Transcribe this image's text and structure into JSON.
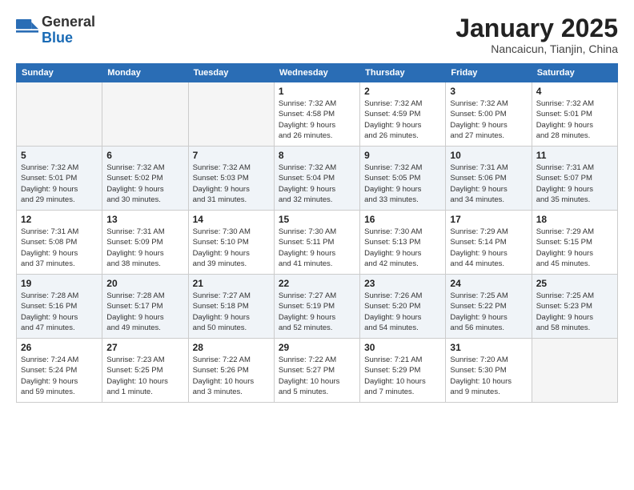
{
  "header": {
    "logo_general": "General",
    "logo_blue": "Blue",
    "month_title": "January 2025",
    "subtitle": "Nancaicun, Tianjin, China"
  },
  "weekdays": [
    "Sunday",
    "Monday",
    "Tuesday",
    "Wednesday",
    "Thursday",
    "Friday",
    "Saturday"
  ],
  "weeks": [
    [
      {
        "day": "",
        "info": ""
      },
      {
        "day": "",
        "info": ""
      },
      {
        "day": "",
        "info": ""
      },
      {
        "day": "1",
        "info": "Sunrise: 7:32 AM\nSunset: 4:58 PM\nDaylight: 9 hours\nand 26 minutes."
      },
      {
        "day": "2",
        "info": "Sunrise: 7:32 AM\nSunset: 4:59 PM\nDaylight: 9 hours\nand 26 minutes."
      },
      {
        "day": "3",
        "info": "Sunrise: 7:32 AM\nSunset: 5:00 PM\nDaylight: 9 hours\nand 27 minutes."
      },
      {
        "day": "4",
        "info": "Sunrise: 7:32 AM\nSunset: 5:01 PM\nDaylight: 9 hours\nand 28 minutes."
      }
    ],
    [
      {
        "day": "5",
        "info": "Sunrise: 7:32 AM\nSunset: 5:01 PM\nDaylight: 9 hours\nand 29 minutes."
      },
      {
        "day": "6",
        "info": "Sunrise: 7:32 AM\nSunset: 5:02 PM\nDaylight: 9 hours\nand 30 minutes."
      },
      {
        "day": "7",
        "info": "Sunrise: 7:32 AM\nSunset: 5:03 PM\nDaylight: 9 hours\nand 31 minutes."
      },
      {
        "day": "8",
        "info": "Sunrise: 7:32 AM\nSunset: 5:04 PM\nDaylight: 9 hours\nand 32 minutes."
      },
      {
        "day": "9",
        "info": "Sunrise: 7:32 AM\nSunset: 5:05 PM\nDaylight: 9 hours\nand 33 minutes."
      },
      {
        "day": "10",
        "info": "Sunrise: 7:31 AM\nSunset: 5:06 PM\nDaylight: 9 hours\nand 34 minutes."
      },
      {
        "day": "11",
        "info": "Sunrise: 7:31 AM\nSunset: 5:07 PM\nDaylight: 9 hours\nand 35 minutes."
      }
    ],
    [
      {
        "day": "12",
        "info": "Sunrise: 7:31 AM\nSunset: 5:08 PM\nDaylight: 9 hours\nand 37 minutes."
      },
      {
        "day": "13",
        "info": "Sunrise: 7:31 AM\nSunset: 5:09 PM\nDaylight: 9 hours\nand 38 minutes."
      },
      {
        "day": "14",
        "info": "Sunrise: 7:30 AM\nSunset: 5:10 PM\nDaylight: 9 hours\nand 39 minutes."
      },
      {
        "day": "15",
        "info": "Sunrise: 7:30 AM\nSunset: 5:11 PM\nDaylight: 9 hours\nand 41 minutes."
      },
      {
        "day": "16",
        "info": "Sunrise: 7:30 AM\nSunset: 5:13 PM\nDaylight: 9 hours\nand 42 minutes."
      },
      {
        "day": "17",
        "info": "Sunrise: 7:29 AM\nSunset: 5:14 PM\nDaylight: 9 hours\nand 44 minutes."
      },
      {
        "day": "18",
        "info": "Sunrise: 7:29 AM\nSunset: 5:15 PM\nDaylight: 9 hours\nand 45 minutes."
      }
    ],
    [
      {
        "day": "19",
        "info": "Sunrise: 7:28 AM\nSunset: 5:16 PM\nDaylight: 9 hours\nand 47 minutes."
      },
      {
        "day": "20",
        "info": "Sunrise: 7:28 AM\nSunset: 5:17 PM\nDaylight: 9 hours\nand 49 minutes."
      },
      {
        "day": "21",
        "info": "Sunrise: 7:27 AM\nSunset: 5:18 PM\nDaylight: 9 hours\nand 50 minutes."
      },
      {
        "day": "22",
        "info": "Sunrise: 7:27 AM\nSunset: 5:19 PM\nDaylight: 9 hours\nand 52 minutes."
      },
      {
        "day": "23",
        "info": "Sunrise: 7:26 AM\nSunset: 5:20 PM\nDaylight: 9 hours\nand 54 minutes."
      },
      {
        "day": "24",
        "info": "Sunrise: 7:25 AM\nSunset: 5:22 PM\nDaylight: 9 hours\nand 56 minutes."
      },
      {
        "day": "25",
        "info": "Sunrise: 7:25 AM\nSunset: 5:23 PM\nDaylight: 9 hours\nand 58 minutes."
      }
    ],
    [
      {
        "day": "26",
        "info": "Sunrise: 7:24 AM\nSunset: 5:24 PM\nDaylight: 9 hours\nand 59 minutes."
      },
      {
        "day": "27",
        "info": "Sunrise: 7:23 AM\nSunset: 5:25 PM\nDaylight: 10 hours\nand 1 minute."
      },
      {
        "day": "28",
        "info": "Sunrise: 7:22 AM\nSunset: 5:26 PM\nDaylight: 10 hours\nand 3 minutes."
      },
      {
        "day": "29",
        "info": "Sunrise: 7:22 AM\nSunset: 5:27 PM\nDaylight: 10 hours\nand 5 minutes."
      },
      {
        "day": "30",
        "info": "Sunrise: 7:21 AM\nSunset: 5:29 PM\nDaylight: 10 hours\nand 7 minutes."
      },
      {
        "day": "31",
        "info": "Sunrise: 7:20 AM\nSunset: 5:30 PM\nDaylight: 10 hours\nand 9 minutes."
      },
      {
        "day": "",
        "info": ""
      }
    ]
  ]
}
